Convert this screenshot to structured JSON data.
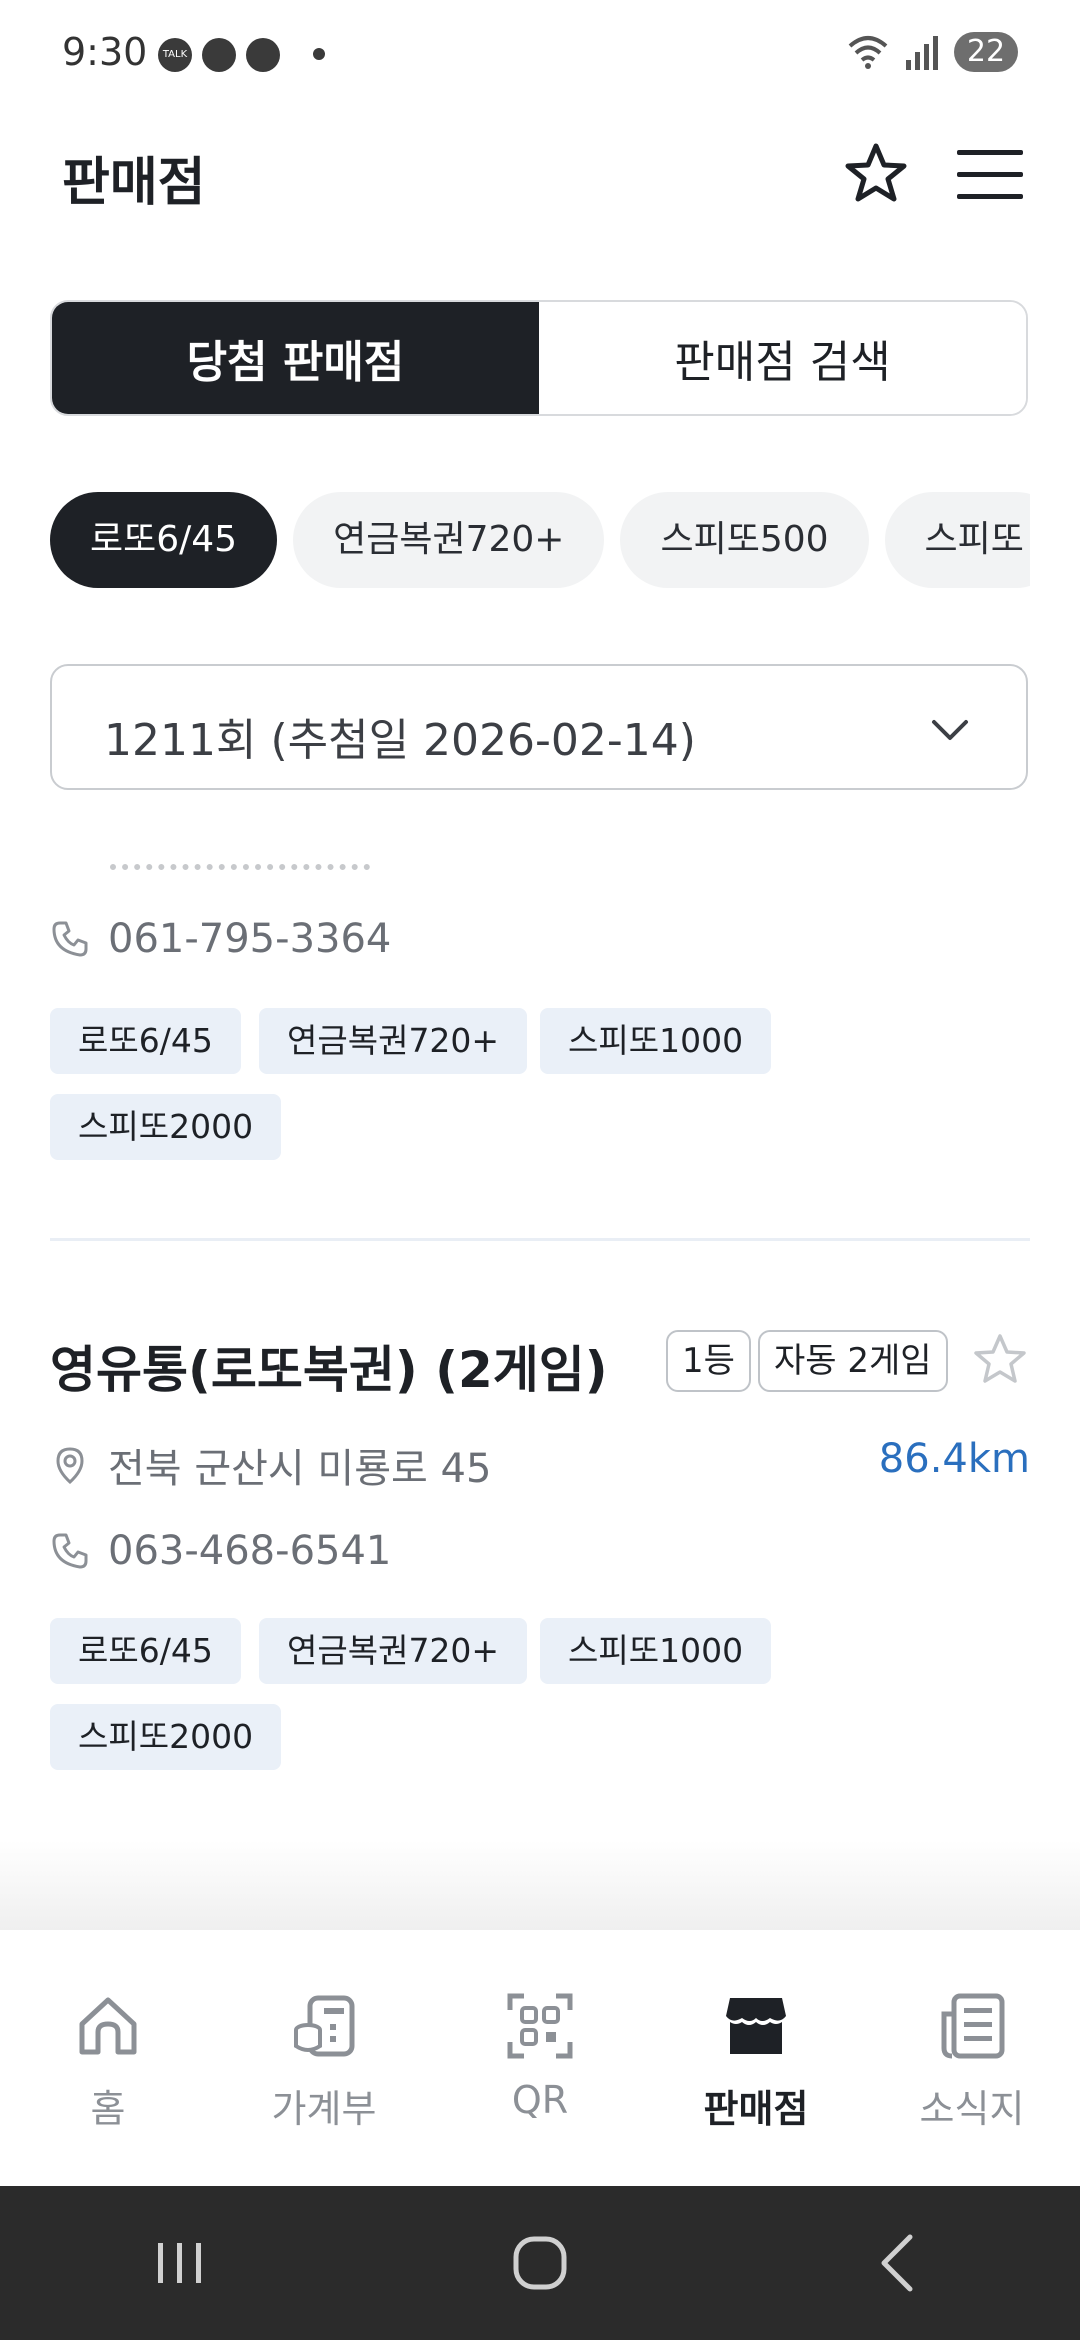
{
  "status_bar": {
    "time": "9:30",
    "battery": "22",
    "talk_label": "TALK"
  },
  "header": {
    "title": "판매점"
  },
  "segments": [
    {
      "label": "당첨 판매점",
      "active": true
    },
    {
      "label": "판매점 검색",
      "active": false
    }
  ],
  "chips": [
    {
      "label": "로또6/45",
      "active": true
    },
    {
      "label": "연금복권720+",
      "active": false
    },
    {
      "label": "스피또500",
      "active": false
    },
    {
      "label": "스피또",
      "active": false
    }
  ],
  "round_select": {
    "value": "1211회 (추첨일 2026-02-14)"
  },
  "stores": [
    {
      "phone": "061-795-3364",
      "tags": [
        "로또6/45",
        "연금복권720+",
        "스피또1000",
        "스피또2000"
      ]
    },
    {
      "name": "영유통(로또복권) (2게임)",
      "rank": "1등",
      "method": "자동 2게임",
      "address": "전북 군산시 미룡로 45",
      "distance": "86.4km",
      "phone": "063-468-6541",
      "tags": [
        "로또6/45",
        "연금복권720+",
        "스피또1000",
        "스피또2000"
      ]
    }
  ],
  "bottom_nav": [
    {
      "label": "홈",
      "icon": "home-icon",
      "active": false
    },
    {
      "label": "가계부",
      "icon": "ledger-icon",
      "active": false
    },
    {
      "label": "QR",
      "icon": "qr-scan-icon",
      "active": false
    },
    {
      "label": "판매점",
      "icon": "store-icon",
      "active": true
    },
    {
      "label": "소식지",
      "icon": "newsletter-icon",
      "active": false
    }
  ],
  "colors": {
    "primary": "#1e2126",
    "accent_blue": "#2a6fbe",
    "tag_bg": "#eaf0f8",
    "chip_bg": "#f2f3f4"
  }
}
